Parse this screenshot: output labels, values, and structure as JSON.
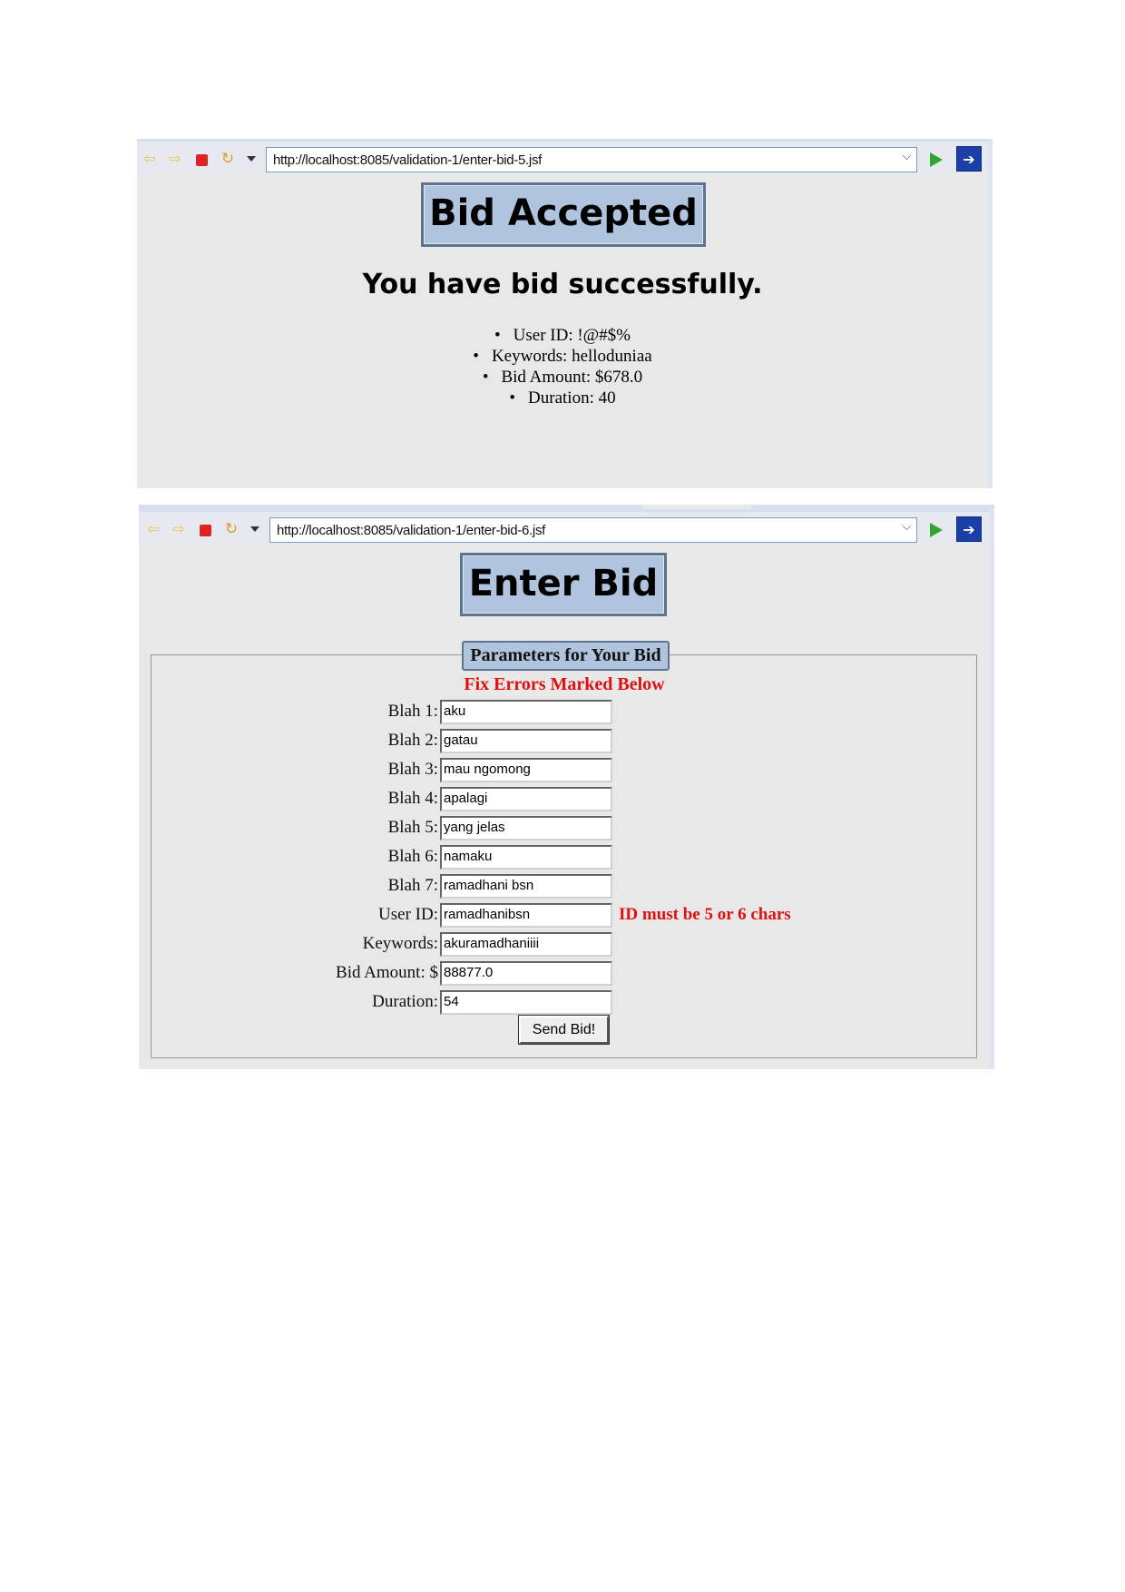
{
  "window1": {
    "url": "http://localhost:8085/validation-1/enter-bid-5.jsf",
    "title": "Bid Accepted",
    "message": "You have bid successfully.",
    "details": [
      "User ID: !@#$%",
      "Keywords: helloduniaa",
      "Bid Amount: $678.0",
      "Duration: 40"
    ]
  },
  "window2": {
    "url": "http://localhost:8085/validation-1/enter-bid-6.jsf",
    "title": "Enter Bid",
    "legend": "Parameters for Your Bid",
    "error_heading": "Fix Errors Marked Below",
    "fields": [
      {
        "label": "Blah 1:",
        "value": "aku",
        "error": ""
      },
      {
        "label": "Blah 2:",
        "value": "gatau",
        "error": ""
      },
      {
        "label": "Blah 3:",
        "value": "mau ngomong",
        "error": ""
      },
      {
        "label": "Blah 4:",
        "value": "apalagi",
        "error": ""
      },
      {
        "label": "Blah 5:",
        "value": "yang jelas",
        "error": ""
      },
      {
        "label": "Blah 6:",
        "value": "namaku",
        "error": ""
      },
      {
        "label": "Blah 7:",
        "value": "ramadhani bsn",
        "error": ""
      },
      {
        "label": "User ID:",
        "value": "ramadhanibsn",
        "error": "ID must be 5 or 6 chars"
      },
      {
        "label": "Keywords:",
        "value": "akuramadhaniiii",
        "error": ""
      },
      {
        "label": "Bid Amount: $",
        "value": "88877.0",
        "error": ""
      },
      {
        "label": "Duration:",
        "value": "54",
        "error": ""
      }
    ],
    "submit_label": "Send Bid!"
  },
  "icons": {
    "back": "back-arrow-icon",
    "forward": "forward-arrow-icon",
    "stop": "stop-icon",
    "refresh": "refresh-icon",
    "go": "go-icon",
    "external": "open-external-icon"
  },
  "colors": {
    "title_bg": "#b0c4de",
    "error": "#e01010",
    "go": "#2fa52f"
  }
}
